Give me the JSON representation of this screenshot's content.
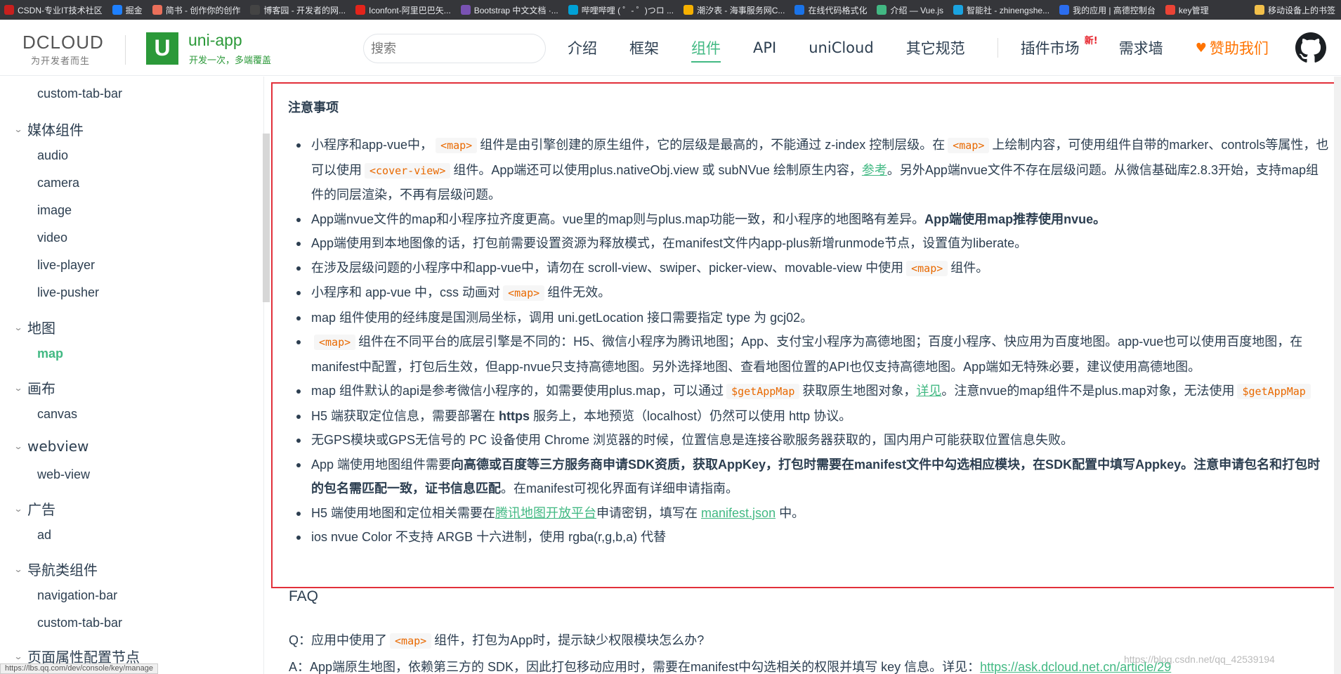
{
  "bookmarks": [
    {
      "label": "CSDN-专业IT技术社区",
      "color": "#c8201e"
    },
    {
      "label": "掘金",
      "color": "#1e80ff"
    },
    {
      "label": "简书 - 创作你的创作",
      "color": "#ea6f5a"
    },
    {
      "label": "博客园 - 开发者的网...",
      "color": "#444444"
    },
    {
      "label": "Iconfont-阿里巴巴矢...",
      "color": "#e3241b"
    },
    {
      "label": "Bootstrap 中文文档 ·...",
      "color": "#7952b3"
    },
    {
      "label": "哔哩哔哩 ( ゜- ゜)つロ ...",
      "color": "#00a1d6"
    },
    {
      "label": "潮汐表 - 海事服务网C...",
      "color": "#f5b000"
    },
    {
      "label": "在线代码格式化",
      "color": "#1a73e8"
    },
    {
      "label": "介绍 — Vue.js",
      "color": "#42b883"
    },
    {
      "label": "智能社 - zhinengshe...",
      "color": "#1aa3e0"
    },
    {
      "label": "我的应用 | 高德控制台",
      "color": "#2b6def"
    },
    {
      "label": "key管理",
      "color": "#ea4335"
    },
    {
      "label": "移动设备上的书签",
      "color": "#f2c04a"
    }
  ],
  "header": {
    "dcloud_logo": "DCLOUD",
    "dcloud_sub": "为开发者而生",
    "uni_icon": "U",
    "uni_title": "uni-app",
    "uni_sub": "开发一次，多端覆盖",
    "search_placeholder": "搜索",
    "nav": {
      "intro": "介绍",
      "framework": "框架",
      "components": "组件",
      "api": "API",
      "unicloud": "uniCloud",
      "other": "其它规范",
      "plugins": "插件市场",
      "new_badge": "新!",
      "wishes": "需求墙",
      "sponsor": "赞助我们"
    }
  },
  "sidebar": {
    "custom_tab_bar_top": "custom-tab-bar",
    "media_group": "媒体组件",
    "audio": "audio",
    "camera": "camera",
    "image": "image",
    "video": "video",
    "live_player": "live-player",
    "live_pusher": "live-pusher",
    "map_group": "地图",
    "map": "map",
    "canvas_group": "画布",
    "canvas": "canvas",
    "webview_group": "webview",
    "web_view": "web-view",
    "ad_group": "广告",
    "ad": "ad",
    "nav_group": "导航类组件",
    "navigation_bar": "navigation-bar",
    "custom_tab_bar": "custom-tab-bar",
    "page_config_group": "页面属性配置节点"
  },
  "status_url": "https://lbs.qq.com/dev/console/key/manage",
  "content": {
    "notice_title": "注意事项",
    "notes": {
      "n1": {
        "t1": "小程序和app-vue中，",
        "c1": "<map>",
        "t2": "组件是由引擎创建的原生组件，它的层级是最高的，不能通过 z-index 控制层级。在",
        "c2": "<map>",
        "t3": "上绘制内容，可使用组件自带的marker、controls等属性，也可以使用",
        "c3": "<cover-view>",
        "t4": "组件。App端还可以使用plus.nativeObj.view 或 subNVue 绘制原生内容，",
        "link": "参考",
        "t5": "。另外App端nvue文件不存在层级问题。从微信基础库2.8.3开始，支持map组件的同层渲染，不再有层级问题。"
      },
      "n2": {
        "t1": "App端nvue文件的map和小程序拉齐度更高。vue里的map则与plus.map功能一致，和小程序的地图略有差异。",
        "b1": "App端使用map推荐使用nvue。"
      },
      "n3": "App端使用到本地图像的话，打包前需要设置资源为释放模式，在manifest文件内app-plus新增runmode节点，设置值为liberate。",
      "n4": {
        "t1": "在涉及层级问题的小程序中和app-vue中，请勿在 scroll-view、swiper、picker-view、movable-view 中使用",
        "c1": "<map>",
        "t2": "组件。"
      },
      "n5": {
        "t1": "小程序和 app-vue 中，css 动画对",
        "c1": "<map>",
        "t2": "组件无效。"
      },
      "n6": "map 组件使用的经纬度是国测局坐标，调用 uni.getLocation 接口需要指定 type 为 gcj02。",
      "n7": {
        "c1": "<map>",
        "t1": "组件在不同平台的底层引擎是不同的：H5、微信小程序为腾讯地图；App、支付宝小程序为高德地图；百度小程序、快应用为百度地图。app-vue也可以使用百度地图，在manifest中配置，打包后生效，但app-nvue只支持高德地图。另外选择地图、查看地图位置的API也仅支持高德地图。App端如无特殊必要，建议使用高德地图。"
      },
      "n8": {
        "t1": "map 组件默认的api是参考微信小程序的，如需要使用plus.map，可以通过",
        "c1": "$getAppMap",
        "t2": "获取原生地图对象，",
        "link": "详见",
        "t3": "。注意nvue的map组件不是plus.map对象，无法使用",
        "c2": "$getAppMap"
      },
      "n9": {
        "t1": "H5 端获取定位信息，需要部署在",
        "b1": "https",
        "t2": "服务上，本地预览（localhost）仍然可以使用 http 协议。"
      },
      "n10": "无GPS模块或GPS无信号的 PC 设备使用 Chrome 浏览器的时候，位置信息是连接谷歌服务器获取的，国内用户可能获取位置信息失败。",
      "n11": {
        "t1": "App 端使用地图组件需要",
        "b1": "向高德或百度等三方服务商申请SDK资质，获取AppKey，打包时需要在manifest文件中勾选相应模块，在SDK配置中填写Appkey。注意申请包名和打包时的包名需匹配一致，证书信息匹配",
        "t2": "。在manifest可视化界面有详细申请指南。"
      },
      "n12": {
        "t1": "H5 端使用地图和定位相关需要在",
        "link1": "腾讯地图开放平台",
        "t2": "申请密钥，填写在",
        "link2": "manifest.json",
        "t3": "中。"
      },
      "n13": "ios nvue Color 不支持 ARGB 十六进制，使用 rgba(r,g,b,a) 代替"
    },
    "faq_title": "FAQ",
    "faq_q": {
      "t1": "Q：应用中使用了",
      "c1": "<map>",
      "t2": "组件，打包为App时，提示缺少权限模块怎么办?"
    },
    "faq_a": {
      "t1": "A：App端原生地图，依赖第三方的 SDK，因此打包移动应用时，需要在manifest中勾选相关的权限并填写 key 信息。详见：",
      "link": "https://ask.dcloud.net.cn/article/29"
    },
    "watermark": "https://blog.csdn.net/qq_42539194"
  },
  "colors": {
    "accent": "#42b983",
    "brand": "#2b9939",
    "highlight_border": "#e2303a",
    "sponsor": "#ff7300"
  }
}
